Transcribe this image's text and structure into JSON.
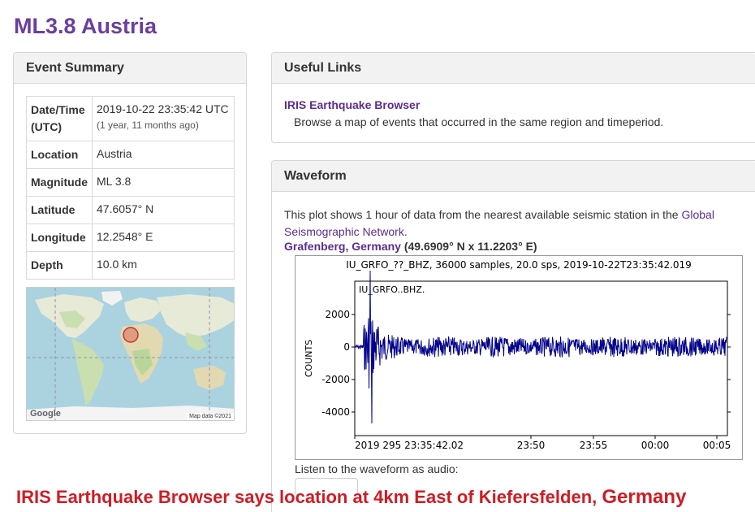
{
  "page_title": "ML3.8 Austria",
  "summary": {
    "heading": "Event Summary",
    "rows": [
      {
        "label": "Date/Time (UTC)",
        "value": "2019-10-22 23:35:42 UTC",
        "sub": "(1 year, 11 months ago)"
      },
      {
        "label": "Location",
        "value": "Austria"
      },
      {
        "label": "Magnitude",
        "value": "ML 3.8"
      },
      {
        "label": "Latitude",
        "value": "47.6057° N"
      },
      {
        "label": "Longitude",
        "value": "12.2548° E"
      },
      {
        "label": "Depth",
        "value": "10.0 km"
      }
    ],
    "map": {
      "logo": "Google",
      "credit": "Map data ©2021"
    }
  },
  "links": {
    "heading": "Useful Links",
    "link_text": "IRIS Earthquake Browser",
    "link_desc": "Browse a map of events that occurred in the same region and timeperiod."
  },
  "waveform": {
    "heading": "Waveform",
    "text_before": "This plot shows 1 hour of data from the nearest available seismic station in the ",
    "text_link": "Global Seismographic Network",
    "text_after": ".",
    "station_name": "Grafenberg, Germany",
    "station_coords": "(49.6909° N x 11.2203° E)",
    "plot_title": "IU_GRFO_??_BHZ, 36000 samples, 20.0 sps, 2019-10-22T23:35:42.019",
    "trace_label": "IU_GRFO..BHZ.",
    "y_label": "COUNTS",
    "y_ticks": [
      "2000",
      "0",
      "-2000",
      "-4000"
    ],
    "x_ticks": [
      "2019 295 23:35:42.02",
      "23:50",
      "23:55",
      "00:00",
      "00:05"
    ],
    "audio_label": "Listen to the waveform as audio:"
  },
  "caption": {
    "text": "IRIS Earthquake Browser says location at 4km East of Kiefersfelden, ",
    "country": "Germany"
  },
  "colors": {
    "title": "#6a3fa0",
    "link": "#5b2c8f",
    "trace": "#00008b",
    "caption": "#d01c24"
  }
}
